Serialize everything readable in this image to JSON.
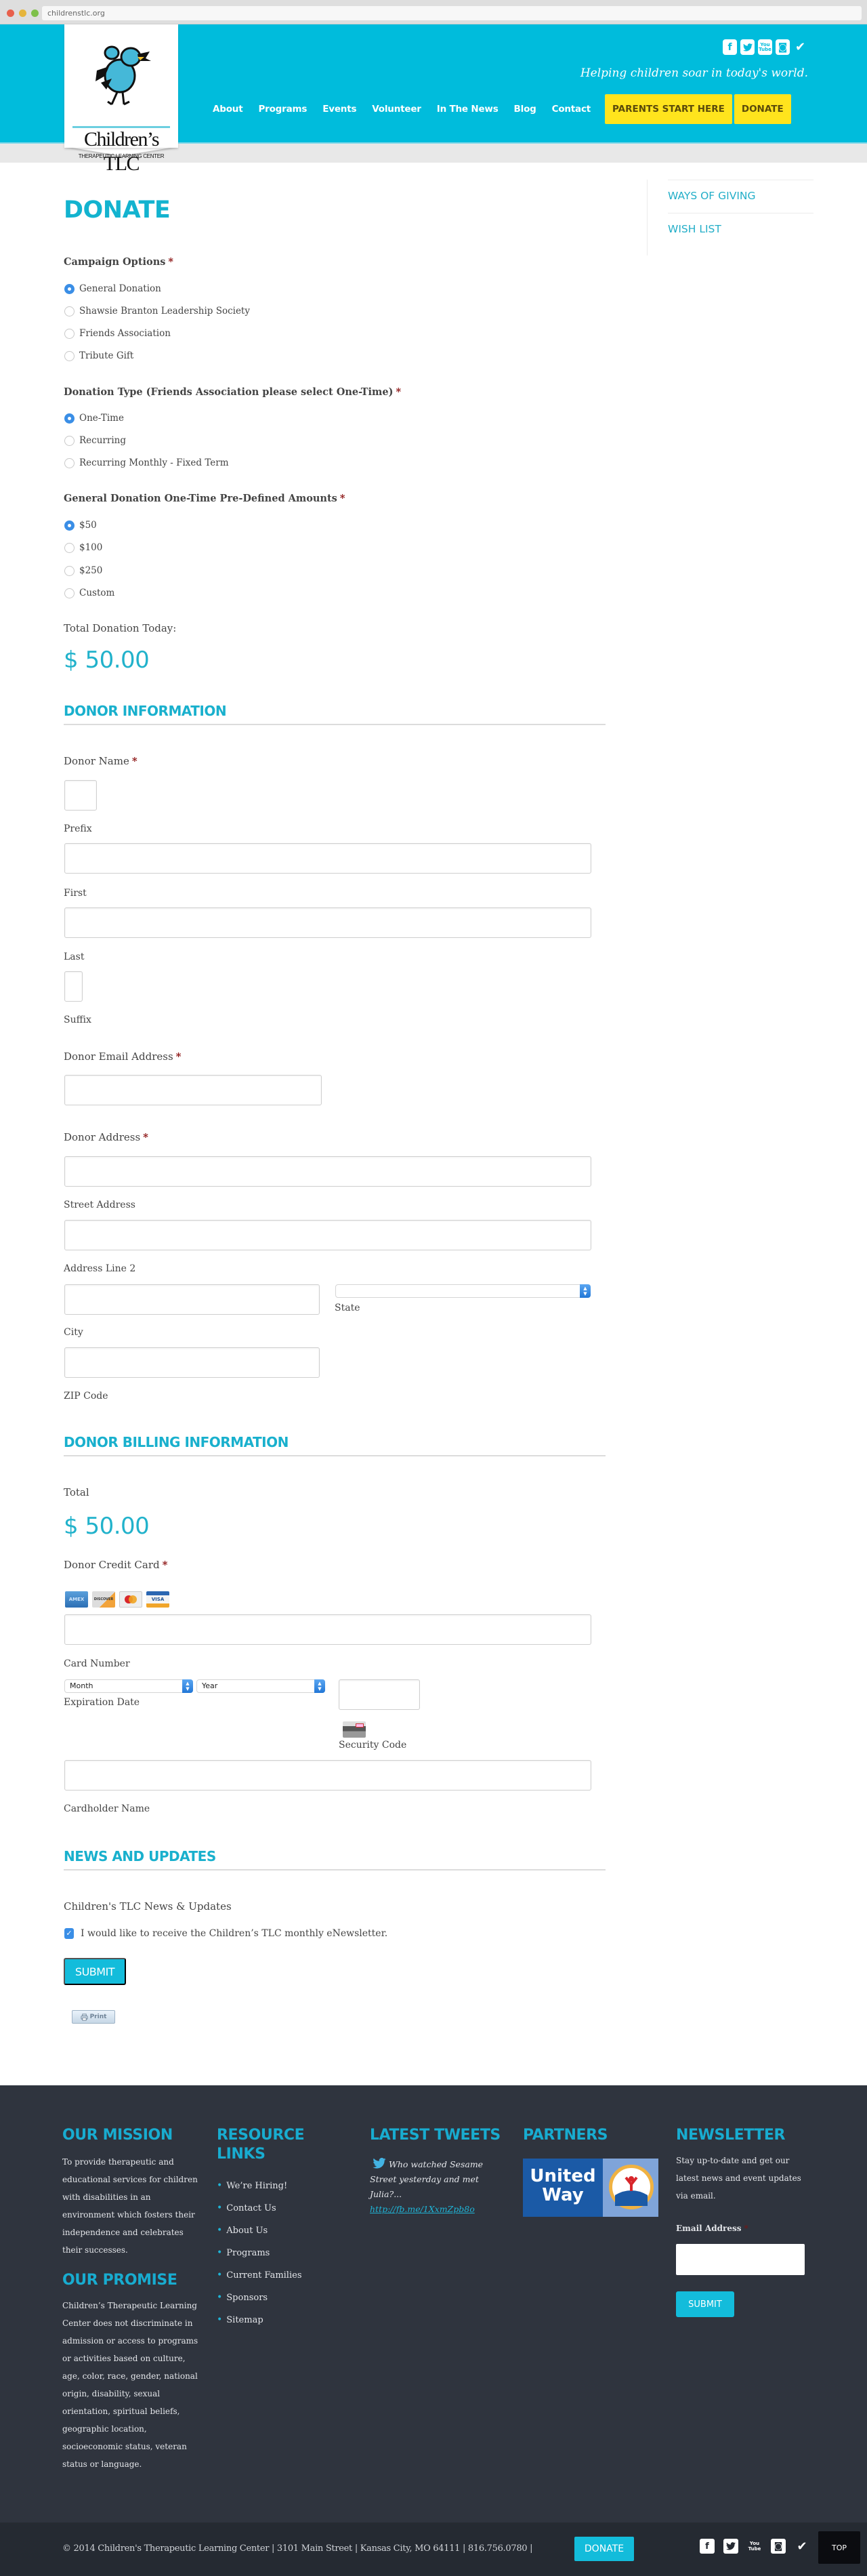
{
  "browser": {
    "url": "childrenstlc.org",
    "dot_colors": [
      "#e8604c",
      "#e6b53c",
      "#7ec04a"
    ]
  },
  "colors": {
    "brand_cyan": "#00bcdc",
    "accent_yellow": "#ffe41d",
    "footer_bg": "#2f343e",
    "radio_selected": "#3a8ee6"
  },
  "logo": {
    "name": "Children’s TLC",
    "subtitle": "THERAPEUTIC LEARNING CENTER"
  },
  "header": {
    "social": [
      {
        "icon": "facebook-icon",
        "glyph": "f"
      },
      {
        "icon": "twitter-icon",
        "glyph": "t"
      },
      {
        "icon": "youtube-icon",
        "glyph_top": "You",
        "glyph_bottom": "Tube"
      },
      {
        "icon": "instagram-icon",
        "glyph": "◙"
      },
      {
        "icon": "foursquare-icon",
        "glyph": "✔"
      }
    ],
    "tagline": "Helping children soar in today's world.",
    "nav": [
      "About",
      "Programs",
      "Events",
      "Volunteer",
      "In The News",
      "Blog",
      "Contact"
    ],
    "cta_parents": "PARENTS START HERE",
    "cta_donate": "DONATE"
  },
  "page": {
    "title": "DONATE"
  },
  "sidebar": {
    "items": [
      "WAYS OF GIVING",
      "WISH LIST"
    ]
  },
  "form": {
    "campaign": {
      "label": "Campaign Options",
      "required": "*",
      "options": [
        "General Donation",
        "Shawsie Branton Leadership Society",
        "Friends Association",
        "Tribute Gift"
      ],
      "selected": "General Donation"
    },
    "donation_type": {
      "label": "Donation Type (Friends Association please select One-Time)",
      "required": "*",
      "options": [
        "One-Time",
        "Recurring",
        "Recurring Monthly - Fixed Term"
      ],
      "selected": "One-Time"
    },
    "amounts": {
      "label": "General Donation One-Time Pre-Defined Amounts",
      "required": "*",
      "options": [
        "$50",
        "$100",
        "$250",
        "Custom"
      ],
      "selected": "$50"
    },
    "total_label": "Total Donation Today:",
    "total_value": "$ 50.00",
    "donor_section": "DONOR INFORMATION",
    "donor_name": {
      "label": "Donor Name",
      "required": "*",
      "prefix_label": "Prefix",
      "prefix_value": "",
      "first_label": "First",
      "first_value": "",
      "last_label": "Last",
      "last_value": "",
      "suffix_label": "Suffix",
      "suffix_value": ""
    },
    "email": {
      "label": "Donor Email Address",
      "required": "*",
      "value": ""
    },
    "address": {
      "label": "Donor Address",
      "required": "*",
      "street_label": "Street Address",
      "line2_label": "Address Line 2",
      "city_label": "City",
      "state_label": "State",
      "state_value": "",
      "zip_label": "ZIP Code"
    },
    "billing_section": "DONOR BILLING INFORMATION",
    "billing_total_label": "Total",
    "billing_total_value": "$ 50.00",
    "credit_card": {
      "label": "Donor Credit Card",
      "required": "*",
      "card_types": [
        "AMEX",
        "DISCOVER",
        "MC",
        "VISA"
      ],
      "card_number_label": "Card Number",
      "month_value": "Month",
      "year_value": "Year",
      "expiration_label": "Expiration Date",
      "security_label": "Security Code",
      "cardholder_label": "Cardholder Name"
    },
    "news_section": "NEWS AND UPDATES",
    "news_label": "Children's TLC News & Updates",
    "newsletter_checkbox": "I would like to receive the Children’s TLC monthly eNewsletter.",
    "newsletter_checked": true,
    "submit": "SUBMIT",
    "print": "Print"
  },
  "footer": {
    "mission_title": "OUR MISSION",
    "mission_text": "To provide therapeutic and educational services for children with disabilities in an environment which fosters their independence and celebrates their successes.",
    "promise_title": "OUR PROMISE",
    "promise_text": "Children’s Therapeutic Learning Center does not discriminate in admission or access to programs or activities based on culture, age, color, race, gender, national origin, disability, sexual orientation, spiritual beliefs, geographic location, socioeconomic status, veteran status or language.",
    "links_title": "RESOURCE LINKS",
    "links": [
      "We’re Hiring!",
      "Contact Us",
      "About Us",
      "Programs",
      "Current Families",
      "Sponsors",
      "Sitemap"
    ],
    "tweets_title": "LATEST TWEETS",
    "tweet_text": "Who watched Sesame Street yesterday and met Julia?...",
    "tweet_link": "http://fb.me/1XxmZpb8o",
    "partners_title": "PARTNERS",
    "partner_name_line1": "United",
    "partner_name_line2": "Way",
    "newsletter_title": "NEWSLETTER",
    "newsletter_text": "Stay up-to-date and get our latest news and event updates via email.",
    "email_label": "Email Address",
    "email_required": "*",
    "email_value": "",
    "submit": "SUBMIT"
  },
  "bottom_bar": {
    "copyright": "© 2014 Children's Therapeutic Learning Center | 3101 Main Street | Kansas City, MO 64111 | 816.756.0780 |",
    "donate": "DONATE",
    "top": "TOP"
  }
}
